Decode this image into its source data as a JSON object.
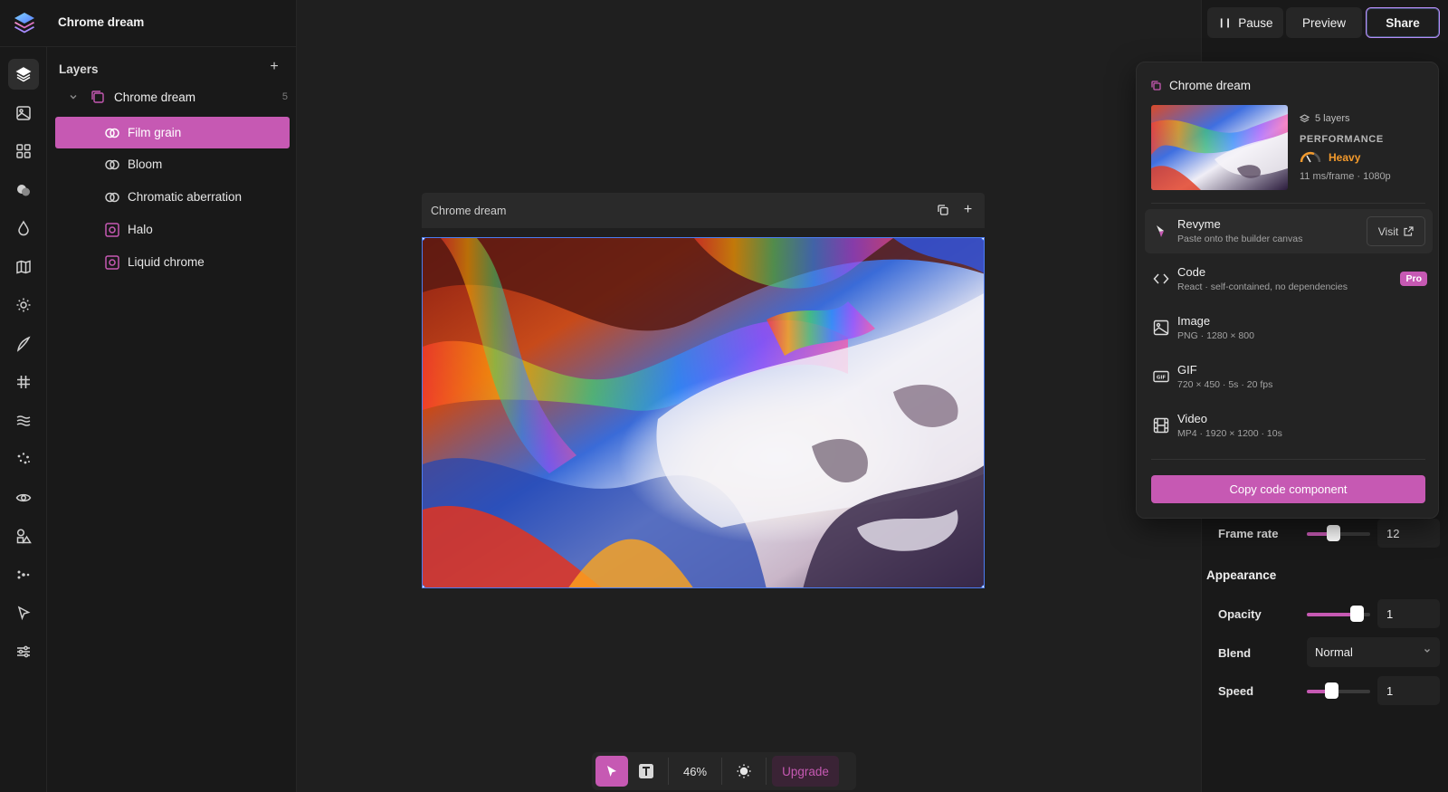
{
  "app": {
    "title": "Chrome dream"
  },
  "rail": {
    "items": [
      "layers-icon",
      "image-icon",
      "grid-icon",
      "blend-icon",
      "drop-icon",
      "map-icon",
      "sun-icon",
      "brush-icon",
      "hash-icon",
      "waves-icon",
      "sparkle-icon",
      "eye-icon",
      "shapes-icon",
      "dots-icon",
      "cursor-icon",
      "sliders-icon"
    ]
  },
  "layers": {
    "heading": "Layers",
    "group": {
      "label": "Chrome dream",
      "count": "5"
    },
    "items": [
      {
        "label": "Film grain",
        "icon": "rings-icon",
        "selected": true
      },
      {
        "label": "Bloom",
        "icon": "rings-icon"
      },
      {
        "label": "Chromatic aberration",
        "icon": "rings-icon"
      },
      {
        "label": "Halo",
        "icon": "square-target-icon"
      },
      {
        "label": "Liquid chrome",
        "icon": "square-target-icon"
      }
    ]
  },
  "canvas": {
    "frame_title": "Chrome dream"
  },
  "toolbar": {
    "zoom": "46%",
    "upgrade_label": "Upgrade"
  },
  "top_actions": {
    "pause_label": "Pause",
    "preview_label": "Preview",
    "share_label": "Share"
  },
  "share": {
    "title": "Chrome dream",
    "layers_meta": "5 layers",
    "performance_title": "PERFORMANCE",
    "performance_value": "Heavy",
    "performance_detail": "11 ms/frame · 1080p",
    "exports": [
      {
        "title": "Revyme",
        "sub": "Paste onto the builder canvas",
        "action": "Visit"
      },
      {
        "title": "Code",
        "sub": "React · self-contained, no dependencies",
        "badge": "Pro"
      },
      {
        "title": "Image",
        "sub": "PNG · 1280 × 800"
      },
      {
        "title": "GIF",
        "sub": "720 × 450 · 5s · 20 fps"
      },
      {
        "title": "Video",
        "sub": "MP4 · 1920 × 1200 · 10s"
      }
    ],
    "copy_label": "Copy code component"
  },
  "properties": {
    "frame_rate": {
      "label": "Frame rate",
      "value": "12",
      "level": 0.4
    },
    "appearance_title": "Appearance",
    "opacity": {
      "label": "Opacity",
      "value": "1",
      "level": 0.88
    },
    "blend": {
      "label": "Blend",
      "value": "Normal"
    },
    "speed": {
      "label": "Speed",
      "value": "1",
      "level": 0.37
    }
  },
  "colors": {
    "accent": "#c659b3",
    "selection": "#4b7cf2",
    "warning": "#f39a2c",
    "panel": "#191919",
    "canvas": "#1f1f1f"
  }
}
